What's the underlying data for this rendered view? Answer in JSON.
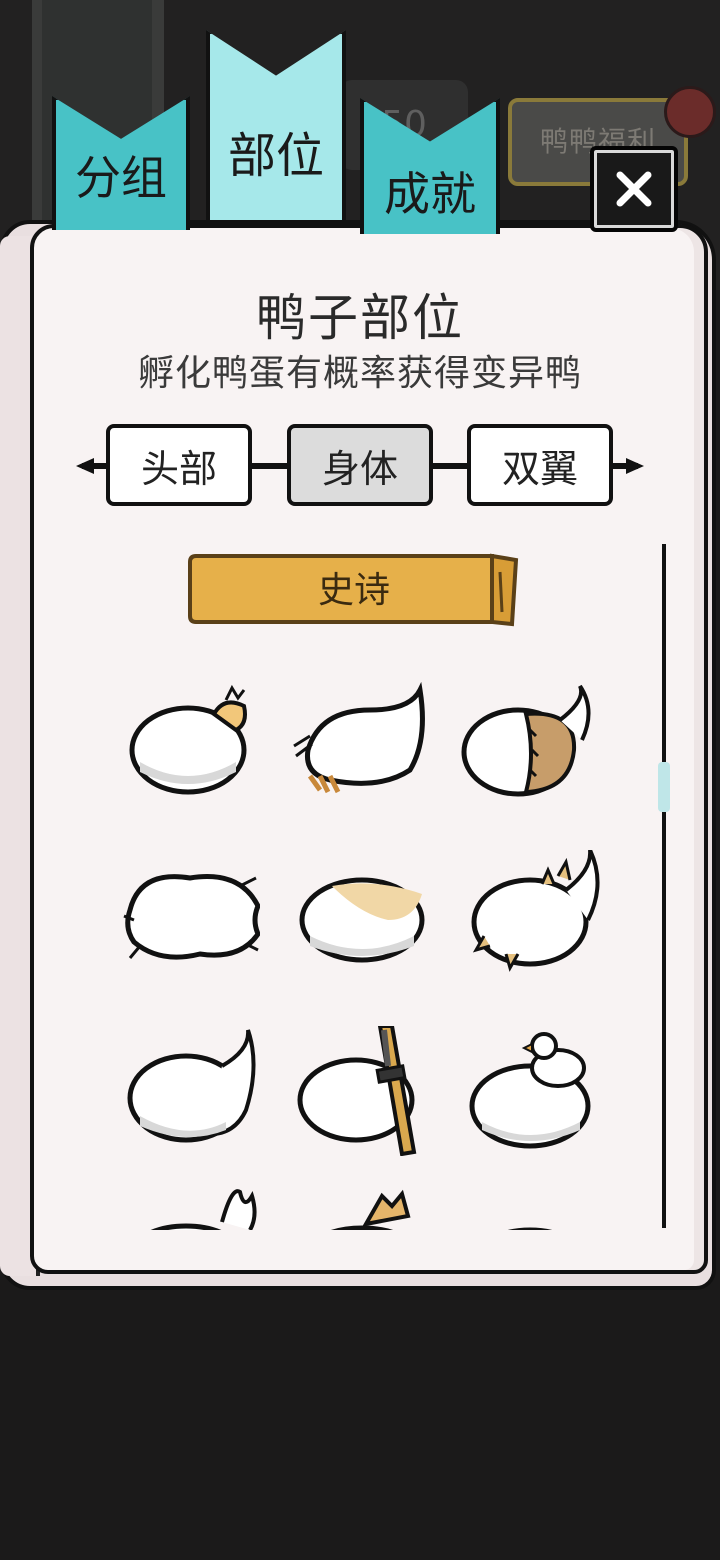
{
  "background": {
    "welfare_label": "鸭鸭福利",
    "counter_text": "50"
  },
  "tabs": [
    {
      "label": "分组",
      "active": false
    },
    {
      "label": "部位",
      "active": true
    },
    {
      "label": "成就",
      "active": false
    }
  ],
  "close_icon": "close-icon",
  "panel": {
    "title": "鸭子部位",
    "subtitle": "孵化鸭蛋有概率获得变异鸭"
  },
  "part_selector": {
    "options": [
      "头部",
      "身体",
      "双翼"
    ],
    "selected": "身体"
  },
  "rarity_banner": "史诗",
  "body_items": [
    {
      "name": "fluffy-bow-body"
    },
    {
      "name": "claw-feather-body"
    },
    {
      "name": "patched-body"
    },
    {
      "name": "shaggy-body"
    },
    {
      "name": "cream-spotted-body"
    },
    {
      "name": "spiked-body"
    },
    {
      "name": "plain-tail-body"
    },
    {
      "name": "katana-body"
    },
    {
      "name": "duckling-rider-body"
    },
    {
      "name": "partial-row-1"
    },
    {
      "name": "partial-row-2"
    },
    {
      "name": "partial-row-3"
    }
  ],
  "colors": {
    "tab_inactive": "#48c2c6",
    "tab_active": "#a6e8ea",
    "banner": "#e6b04a",
    "page": "#f8f3f3",
    "scroll_thumb": "#bfe6e8"
  }
}
